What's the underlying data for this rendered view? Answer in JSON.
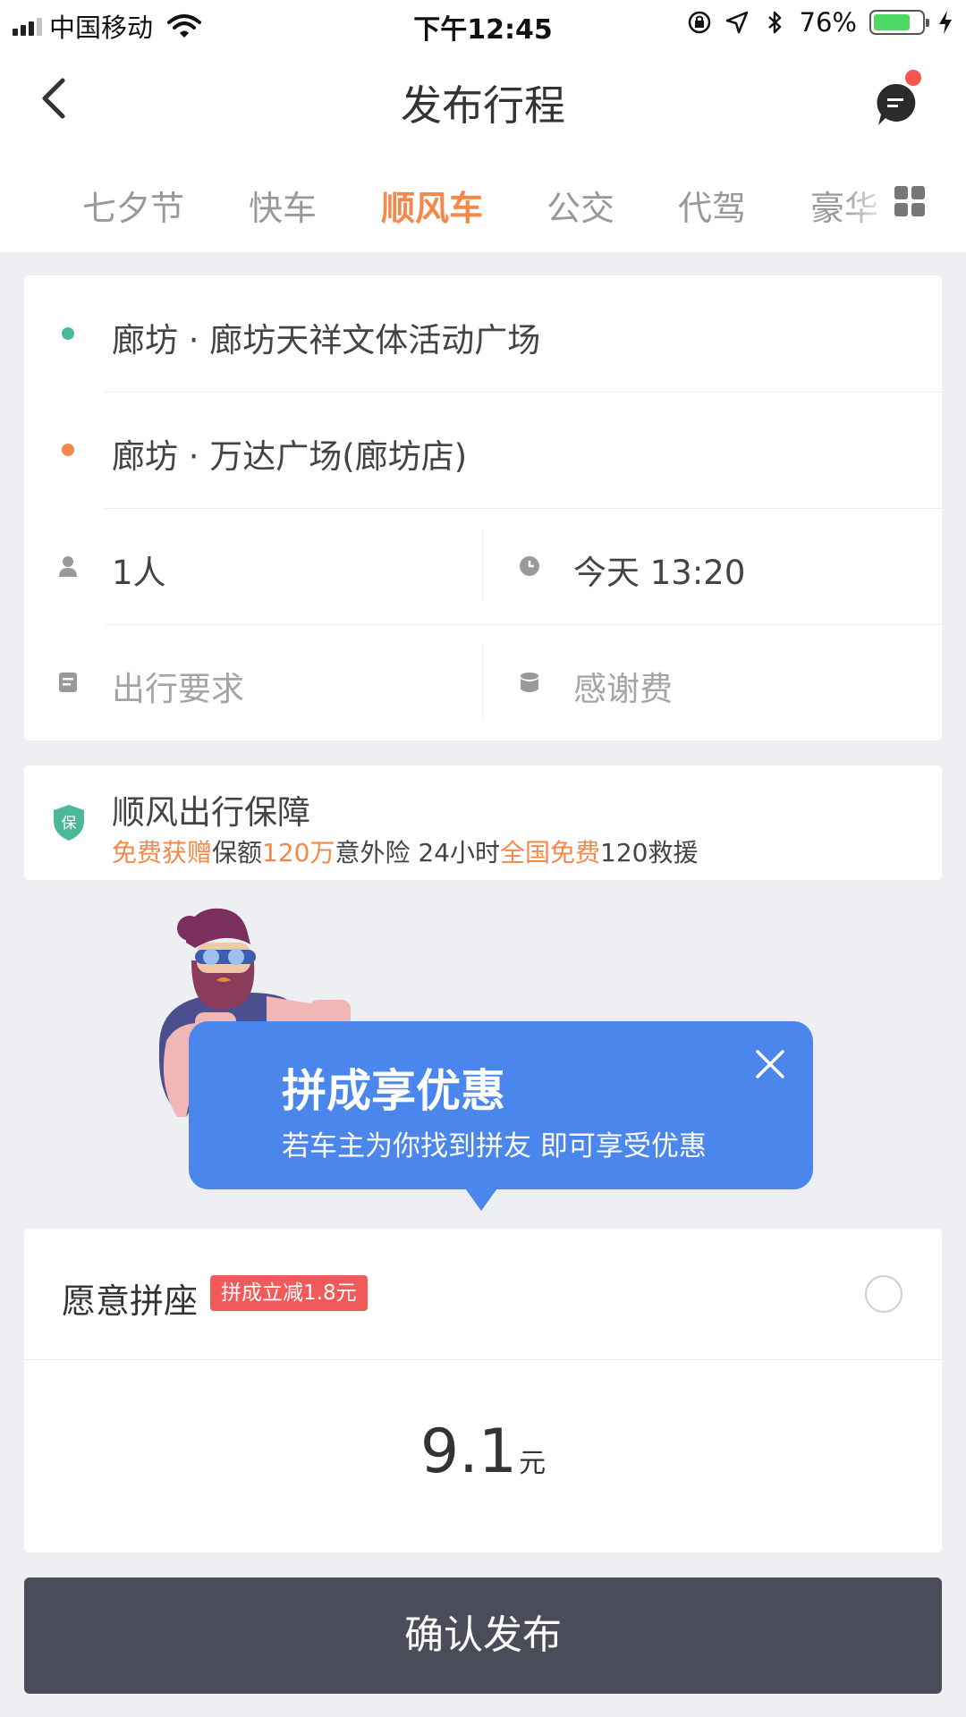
{
  "status_bar": {
    "carrier": "中国移动",
    "time": "下午12:45",
    "battery_percent": "76%",
    "battery_level": 0.76
  },
  "nav": {
    "title": "发布行程",
    "back_icon": "chevron-left-icon",
    "message_icon": "chat-bubble-icon"
  },
  "tabs": [
    {
      "label": "七夕节",
      "active": false
    },
    {
      "label": "快车",
      "active": false
    },
    {
      "label": "顺风车",
      "active": true
    },
    {
      "label": "公交",
      "active": false
    },
    {
      "label": "代驾",
      "active": false
    },
    {
      "label": "豪华",
      "active": false
    }
  ],
  "trip": {
    "start": "廊坊 · 廊坊天祥文体活动广场",
    "end": "廊坊 · 万达广场(廊坊店)",
    "passengers": "1人",
    "time": "今天 13:20",
    "requirements_placeholder": "出行要求",
    "tip_placeholder": "感谢费",
    "colors": {
      "start_dot": "#4cb89a",
      "end_dot": "#f4884a"
    }
  },
  "insurance": {
    "title": "顺风出行保障",
    "shield_label": "保",
    "line": [
      "免费获赠",
      "保额",
      "120万",
      "意外险 24小时",
      "全国免费",
      "120救援"
    ]
  },
  "promo": {
    "title": "拼成享优惠",
    "subtitle": "若车主为你找到拼友 即可享受优惠"
  },
  "carpool": {
    "label": "愿意拼座",
    "badge": "拼成立减1.8元",
    "selected": false
  },
  "price": {
    "amount": "9.1",
    "unit": "元"
  },
  "confirm_label": "确认发布",
  "colors": {
    "accent": "#f4884a",
    "promo_blue": "#4a86ec",
    "badge_red": "#f25a5a",
    "button_dark": "#4a4c59"
  }
}
